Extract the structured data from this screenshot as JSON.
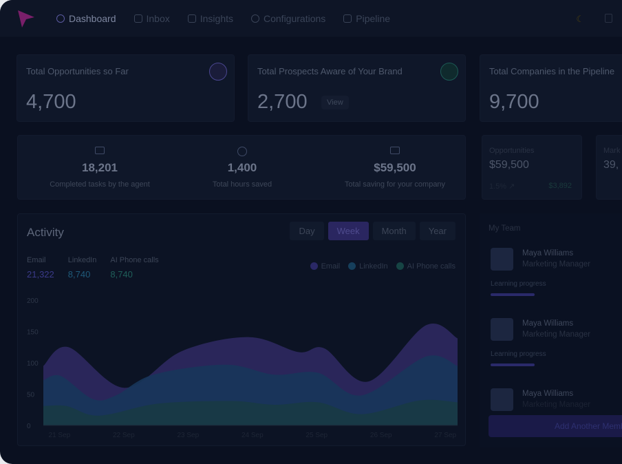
{
  "nav": {
    "items": [
      {
        "label": "Dashboard",
        "icon": "pie-chart-icon",
        "active": true
      },
      {
        "label": "Inbox",
        "icon": "inbox-icon"
      },
      {
        "label": "Insights",
        "icon": "insights-icon"
      },
      {
        "label": "Configurations",
        "icon": "gear-icon"
      },
      {
        "label": "Pipeline",
        "icon": "clipboard-icon"
      }
    ]
  },
  "cards": [
    {
      "title": "Total Opportunities so Far",
      "value": "4,700"
    },
    {
      "title": "Total Prospects Aware of Your Brand",
      "value": "2,700",
      "view": "View"
    },
    {
      "title": "Total Companies in the Pipeline",
      "value": "9,700"
    }
  ],
  "stats": [
    {
      "value": "18,201",
      "label": "Completed tasks by the agent",
      "icon": "laptop-icon"
    },
    {
      "value": "1,400",
      "label": "Total hours saved",
      "icon": "clock-icon"
    },
    {
      "value": "$59,500",
      "label": "Total saving for your company",
      "icon": "money-icon"
    }
  ],
  "mini": [
    {
      "title": "Opportunities",
      "value": "$59,500",
      "foot_left": "1.5% ↗",
      "foot_right": "$3,892"
    },
    {
      "title": "Mark",
      "value": "39,"
    }
  ],
  "activity": {
    "title": "Activity",
    "tabs": [
      "Day",
      "Week",
      "Month",
      "Year"
    ],
    "active_tab": "Week",
    "totals": [
      {
        "label": "Email",
        "value": "21,322",
        "color": "#3b3a8a"
      },
      {
        "label": "LinkedIn",
        "value": "8,740",
        "color": "#1f5a7a"
      },
      {
        "label": "AI Phone calls",
        "value": "8,740",
        "color": "#1f5f5a"
      }
    ]
  },
  "chart_data": {
    "type": "area",
    "xlabel": "",
    "ylabel": "",
    "ylim": [
      0,
      200
    ],
    "yticks": [
      "0",
      "50",
      "100",
      "150",
      "200"
    ],
    "xticks": [
      "21 Sep",
      "22 Sep",
      "23 Sep",
      "24 Sep",
      "25 Sep",
      "26 Sep",
      "27 Sep"
    ],
    "xlim": [
      20.75,
      27.19
    ],
    "grid": false,
    "legend": "top-right",
    "series": [
      {
        "name": "Email",
        "color": "#2d2960",
        "x": [
          20.75,
          21.14,
          22.01,
          22.91,
          23.95,
          24.72,
          25.12,
          25.8,
          26.7,
          27.19
        ],
        "y": [
          95,
          125,
          60,
          119,
          141,
          117,
          123,
          70,
          160,
          139
        ]
      },
      {
        "name": "LinkedIn",
        "color": "#17365a",
        "x": [
          20.75,
          21.02,
          21.52,
          21.88,
          22.46,
          23.58,
          24.34,
          25.02,
          25.7,
          26.7,
          27.19
        ],
        "y": [
          72,
          79,
          42,
          48,
          81,
          97,
          81,
          84,
          48,
          110,
          95
        ]
      },
      {
        "name": "AI Phone calls",
        "color": "#183a44",
        "x": [
          20.75,
          21.11,
          21.47,
          21.79,
          22.55,
          23.68,
          24.34,
          25.02,
          25.7,
          26.6,
          27.19
        ],
        "y": [
          31,
          31,
          17,
          18,
          35,
          39,
          33,
          37,
          18,
          40,
          37
        ]
      }
    ]
  },
  "team": {
    "title": "My Team",
    "members": [
      {
        "name": "Maya Williams",
        "role": "Marketing Manager",
        "progress_label": "Learning progress",
        "progress": 0.35
      },
      {
        "name": "Maya Williams",
        "role": "Marketing Manager",
        "progress_label": "Learning progress",
        "progress": 0.35
      },
      {
        "name": "Maya Williams",
        "role": "Marketing Manager"
      }
    ],
    "add_label": "Add Another Member"
  }
}
